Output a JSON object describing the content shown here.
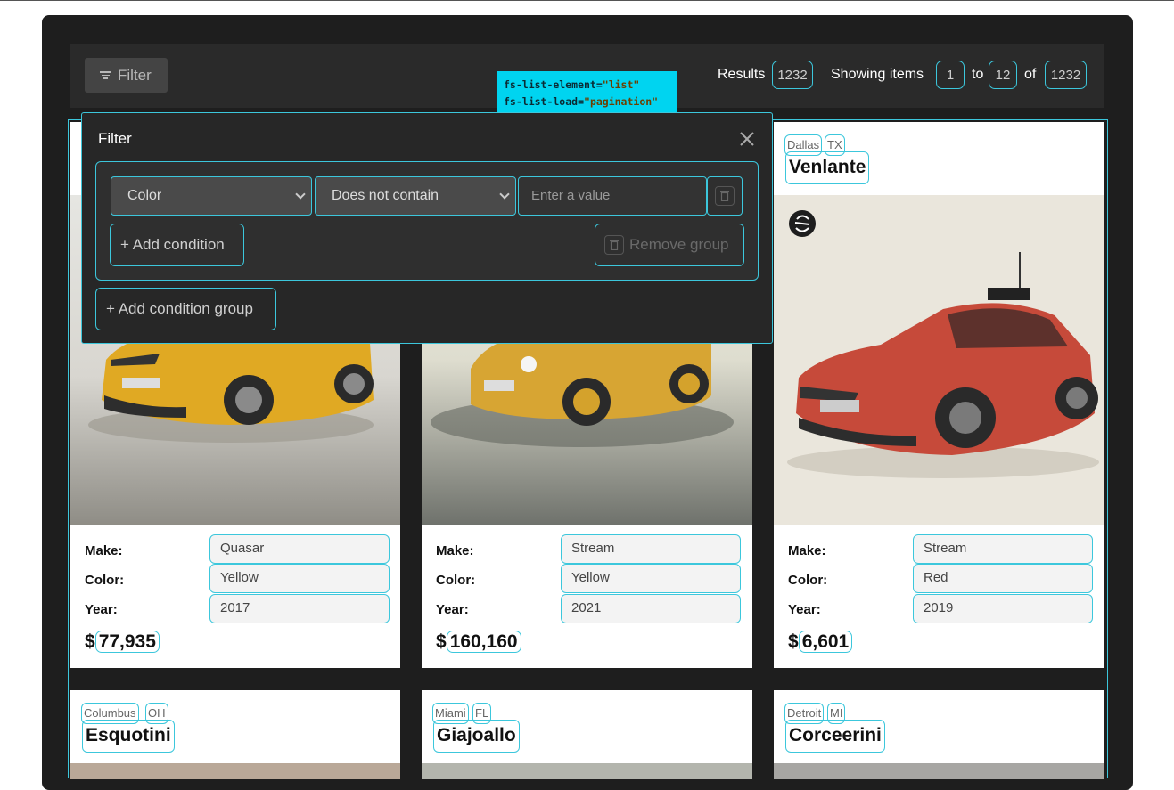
{
  "toolbar": {
    "filter_label": "Filter",
    "results_label": "Results",
    "results_count": "1232",
    "showing_label": "Showing items",
    "from": "1",
    "to_label": "to",
    "to": "12",
    "of_label": "of",
    "total": "1232"
  },
  "tooltip": {
    "line1_attr": "fs-list-element=",
    "line1_val": "\"list\"",
    "line2_attr": "fs-list-load=",
    "line2_val": "\"pagination\""
  },
  "filter_panel": {
    "title": "Filter",
    "field_select": "Color",
    "operator_select": "Does not contain",
    "value_placeholder": "Enter a value",
    "add_condition": "+ Add condition",
    "remove_group": "Remove group",
    "add_condition_group": "+ Add condition group"
  },
  "labels": {
    "make": "Make:",
    "color": "Color:",
    "year": "Year:",
    "currency": "$"
  },
  "cards": [
    {
      "city": "",
      "state": "",
      "name": "",
      "make": "Quasar",
      "color": "Yellow",
      "year": "2017",
      "price": "77,935"
    },
    {
      "city": "",
      "state": "",
      "name": "",
      "make": "Stream",
      "color": "Yellow",
      "year": "2021",
      "price": "160,160"
    },
    {
      "city": "Dallas",
      "state": "TX",
      "name": "Venlante",
      "make": "Stream",
      "color": "Red",
      "year": "2019",
      "price": "6,601"
    },
    {
      "city": "Columbus",
      "state": "OH",
      "name": "Esquotini"
    },
    {
      "city": "Miami",
      "state": "FL",
      "name": "Giajoallo"
    },
    {
      "city": "Detroit",
      "state": "MI",
      "name": "Corceerini"
    }
  ],
  "colors": {
    "accent_outline": "#3cc7dc",
    "tooltip_bg": "#00d4f0",
    "frame_bg": "#1e1e1e"
  }
}
